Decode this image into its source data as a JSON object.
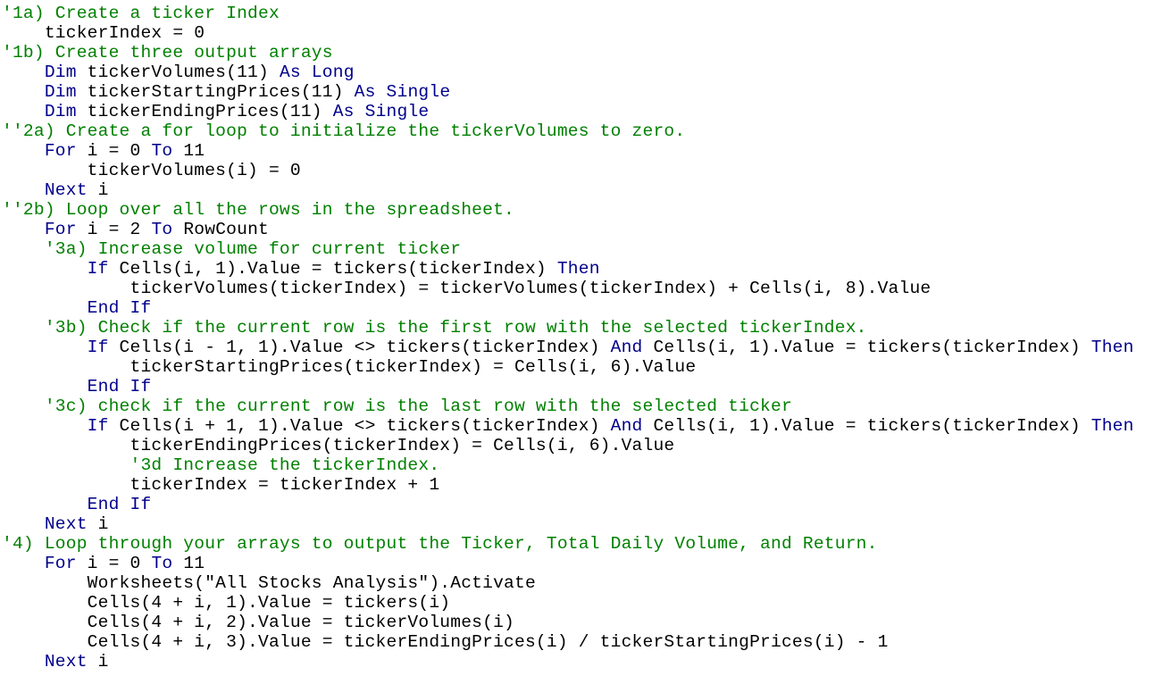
{
  "colors": {
    "comment": "#008000",
    "keyword": "#00008b",
    "text": "#000000",
    "background": "#ffffff"
  },
  "code_lines": [
    [
      {
        "t": "'1a) Create a ticker Index",
        "c": "c"
      }
    ],
    [
      {
        "t": "    tickerIndex = 0",
        "c": ""
      }
    ],
    [
      {
        "t": "'1b) Create three output arrays",
        "c": "c"
      }
    ],
    [
      {
        "t": "    ",
        "c": ""
      },
      {
        "t": "Dim",
        "c": "k"
      },
      {
        "t": " tickerVolumes(11) ",
        "c": ""
      },
      {
        "t": "As",
        "c": "k"
      },
      {
        "t": " ",
        "c": ""
      },
      {
        "t": "Long",
        "c": "k"
      }
    ],
    [
      {
        "t": "    ",
        "c": ""
      },
      {
        "t": "Dim",
        "c": "k"
      },
      {
        "t": " tickerStartingPrices(11) ",
        "c": ""
      },
      {
        "t": "As",
        "c": "k"
      },
      {
        "t": " ",
        "c": ""
      },
      {
        "t": "Single",
        "c": "k"
      }
    ],
    [
      {
        "t": "    ",
        "c": ""
      },
      {
        "t": "Dim",
        "c": "k"
      },
      {
        "t": " tickerEndingPrices(11) ",
        "c": ""
      },
      {
        "t": "As",
        "c": "k"
      },
      {
        "t": " ",
        "c": ""
      },
      {
        "t": "Single",
        "c": "k"
      }
    ],
    [
      {
        "t": "''2a) Create a for loop to initialize the tickerVolumes to zero.",
        "c": "c"
      }
    ],
    [
      {
        "t": "    ",
        "c": ""
      },
      {
        "t": "For",
        "c": "k"
      },
      {
        "t": " i = 0 ",
        "c": ""
      },
      {
        "t": "To",
        "c": "k"
      },
      {
        "t": " 11",
        "c": ""
      }
    ],
    [
      {
        "t": "        tickerVolumes(i) = 0",
        "c": ""
      }
    ],
    [
      {
        "t": "    ",
        "c": ""
      },
      {
        "t": "Next",
        "c": "k"
      },
      {
        "t": " i",
        "c": ""
      }
    ],
    [
      {
        "t": "''2b) Loop over all the rows in the spreadsheet.",
        "c": "c"
      }
    ],
    [
      {
        "t": "    ",
        "c": ""
      },
      {
        "t": "For",
        "c": "k"
      },
      {
        "t": " i = 2 ",
        "c": ""
      },
      {
        "t": "To",
        "c": "k"
      },
      {
        "t": " RowCount",
        "c": ""
      }
    ],
    [
      {
        "t": "    '3a) Increase volume for current ticker",
        "c": "c"
      }
    ],
    [
      {
        "t": "        ",
        "c": ""
      },
      {
        "t": "If",
        "c": "k"
      },
      {
        "t": " Cells(i, 1).Value = tickers(tickerIndex) ",
        "c": ""
      },
      {
        "t": "Then",
        "c": "k"
      }
    ],
    [
      {
        "t": "            tickerVolumes(tickerIndex) = tickerVolumes(tickerIndex) + Cells(i, 8).Value",
        "c": ""
      }
    ],
    [
      {
        "t": "        ",
        "c": ""
      },
      {
        "t": "End If",
        "c": "k"
      }
    ],
    [
      {
        "t": "    '3b) Check if the current row is the first row with the selected tickerIndex.",
        "c": "c"
      }
    ],
    [
      {
        "t": "        ",
        "c": ""
      },
      {
        "t": "If",
        "c": "k"
      },
      {
        "t": " Cells(i - 1, 1).Value <> tickers(tickerIndex) ",
        "c": ""
      },
      {
        "t": "And",
        "c": "k"
      },
      {
        "t": " Cells(i, 1).Value = tickers(tickerIndex) ",
        "c": ""
      },
      {
        "t": "Then",
        "c": "k"
      }
    ],
    [
      {
        "t": "            tickerStartingPrices(tickerIndex) = Cells(i, 6).Value",
        "c": ""
      }
    ],
    [
      {
        "t": "        ",
        "c": ""
      },
      {
        "t": "End If",
        "c": "k"
      }
    ],
    [
      {
        "t": "    '3c) check if the current row is the last row with the selected ticker",
        "c": "c"
      }
    ],
    [
      {
        "t": "        ",
        "c": ""
      },
      {
        "t": "If",
        "c": "k"
      },
      {
        "t": " Cells(i + 1, 1).Value <> tickers(tickerIndex) ",
        "c": ""
      },
      {
        "t": "And",
        "c": "k"
      },
      {
        "t": " Cells(i, 1).Value = tickers(tickerIndex) ",
        "c": ""
      },
      {
        "t": "Then",
        "c": "k"
      }
    ],
    [
      {
        "t": "            tickerEndingPrices(tickerIndex) = Cells(i, 6).Value",
        "c": ""
      }
    ],
    [
      {
        "t": "            '3d Increase the tickerIndex.",
        "c": "c"
      }
    ],
    [
      {
        "t": "            tickerIndex = tickerIndex + 1",
        "c": ""
      }
    ],
    [
      {
        "t": "        ",
        "c": ""
      },
      {
        "t": "End If",
        "c": "k"
      }
    ],
    [
      {
        "t": "    ",
        "c": ""
      },
      {
        "t": "Next",
        "c": "k"
      },
      {
        "t": " i",
        "c": ""
      }
    ],
    [
      {
        "t": "'4) Loop through your arrays to output the Ticker, Total Daily Volume, and Return.",
        "c": "c"
      }
    ],
    [
      {
        "t": "    ",
        "c": ""
      },
      {
        "t": "For",
        "c": "k"
      },
      {
        "t": " i = 0 ",
        "c": ""
      },
      {
        "t": "To",
        "c": "k"
      },
      {
        "t": " 11",
        "c": ""
      }
    ],
    [
      {
        "t": "        Worksheets(\"All Stocks Analysis\").Activate",
        "c": ""
      }
    ],
    [
      {
        "t": "        Cells(4 + i, 1).Value = tickers(i)",
        "c": ""
      }
    ],
    [
      {
        "t": "        Cells(4 + i, 2).Value = tickerVolumes(i)",
        "c": ""
      }
    ],
    [
      {
        "t": "        Cells(4 + i, 3).Value = tickerEndingPrices(i) / tickerStartingPrices(i) - 1",
        "c": ""
      }
    ],
    [
      {
        "t": "    ",
        "c": ""
      },
      {
        "t": "Next",
        "c": "k"
      },
      {
        "t": " i",
        "c": ""
      }
    ]
  ]
}
